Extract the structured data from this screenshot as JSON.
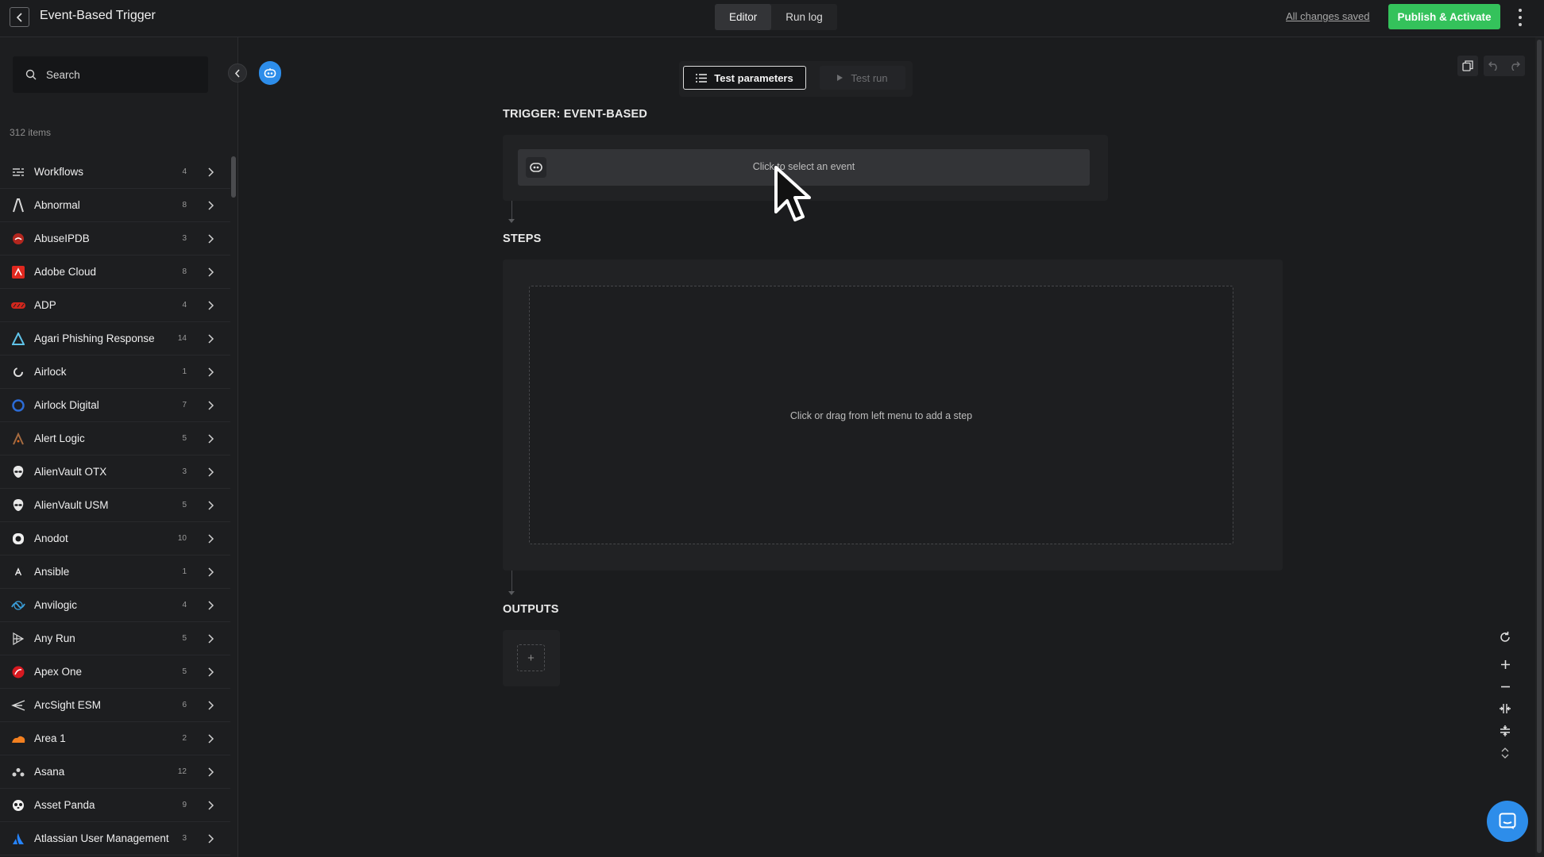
{
  "header": {
    "title": "Event-Based Trigger",
    "tabs": [
      "Editor",
      "Run log"
    ],
    "active_tab": "Editor",
    "save_status": "All changes saved",
    "publish_label": "Publish & Activate"
  },
  "sidebar": {
    "search_placeholder": "Search",
    "items_count": "312 items",
    "items": [
      {
        "label": "Workflows",
        "count": "4",
        "icon": "workflows-icon"
      },
      {
        "label": "Abnormal",
        "count": "8",
        "icon": "abnormal-icon"
      },
      {
        "label": "AbuseIPDB",
        "count": "3",
        "icon": "abuseipdb-icon"
      },
      {
        "label": "Adobe Cloud",
        "count": "8",
        "icon": "adobe-icon"
      },
      {
        "label": "ADP",
        "count": "4",
        "icon": "adp-icon"
      },
      {
        "label": "Agari Phishing Response",
        "count": "14",
        "icon": "agari-icon"
      },
      {
        "label": "Airlock",
        "count": "1",
        "icon": "airlock-icon"
      },
      {
        "label": "Airlock Digital",
        "count": "7",
        "icon": "airlock-digital-icon"
      },
      {
        "label": "Alert Logic",
        "count": "5",
        "icon": "alert-logic-icon"
      },
      {
        "label": "AlienVault OTX",
        "count": "3",
        "icon": "alien-icon"
      },
      {
        "label": "AlienVault USM",
        "count": "5",
        "icon": "alien-icon"
      },
      {
        "label": "Anodot",
        "count": "10",
        "icon": "anodot-icon"
      },
      {
        "label": "Ansible",
        "count": "1",
        "icon": "ansible-icon"
      },
      {
        "label": "Anvilogic",
        "count": "4",
        "icon": "anvilogic-icon"
      },
      {
        "label": "Any Run",
        "count": "5",
        "icon": "any-run-icon"
      },
      {
        "label": "Apex One",
        "count": "5",
        "icon": "apex-one-icon"
      },
      {
        "label": "ArcSight ESM",
        "count": "6",
        "icon": "arcsight-icon"
      },
      {
        "label": "Area 1",
        "count": "2",
        "icon": "area1-icon"
      },
      {
        "label": "Asana",
        "count": "12",
        "icon": "asana-icon"
      },
      {
        "label": "Asset Panda",
        "count": "9",
        "icon": "asset-panda-icon"
      },
      {
        "label": "Atlassian User Management",
        "count": "3",
        "icon": "atlassian-icon"
      }
    ]
  },
  "toolbar": {
    "test_params_label": "Test parameters",
    "test_run_label": "Test run"
  },
  "canvas": {
    "trigger_heading": "TRIGGER: EVENT-BASED",
    "event_placeholder": "Click to select an event",
    "steps_heading": "STEPS",
    "steps_placeholder": "Click or drag from left menu to add a step",
    "outputs_heading": "OUTPUTS",
    "outputs_add": "+"
  },
  "colors": {
    "background": "#1b1c1e",
    "publish_green": "#34c25b",
    "accent_blue": "#2d8dea"
  }
}
